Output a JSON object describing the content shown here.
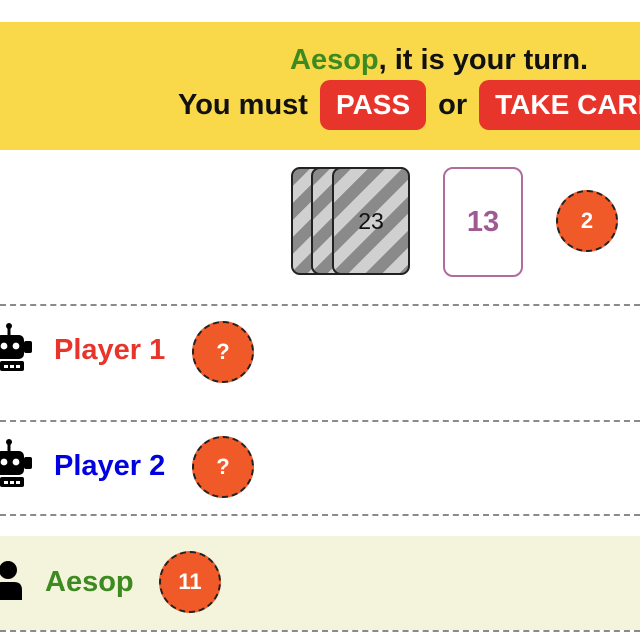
{
  "banner": {
    "player": "Aesop",
    "turn_text": ", it is your turn.",
    "must_text": "You must",
    "pass_label": "PASS",
    "or_text": "or",
    "take_label": "TAKE CARD"
  },
  "table": {
    "deck_count": "23",
    "face_card": "13",
    "pot_tokens": "2"
  },
  "players": [
    {
      "name": "Player 1",
      "type": "robot-icon",
      "tokens": "?",
      "color": "#e8352b"
    },
    {
      "name": "Player 2",
      "type": "robot-icon",
      "tokens": "?",
      "color": "#0000e0"
    },
    {
      "name": "Aesop",
      "type": "person-icon",
      "tokens": "11",
      "color": "#3c8a20"
    }
  ],
  "colors": {
    "banner_bg": "#f9d84a",
    "button_red": "#e8352b",
    "token_orange": "#ef5a28",
    "green": "#3c8a20",
    "highlight_row": "#f4f4dc",
    "card_border": "#b06c9c"
  }
}
